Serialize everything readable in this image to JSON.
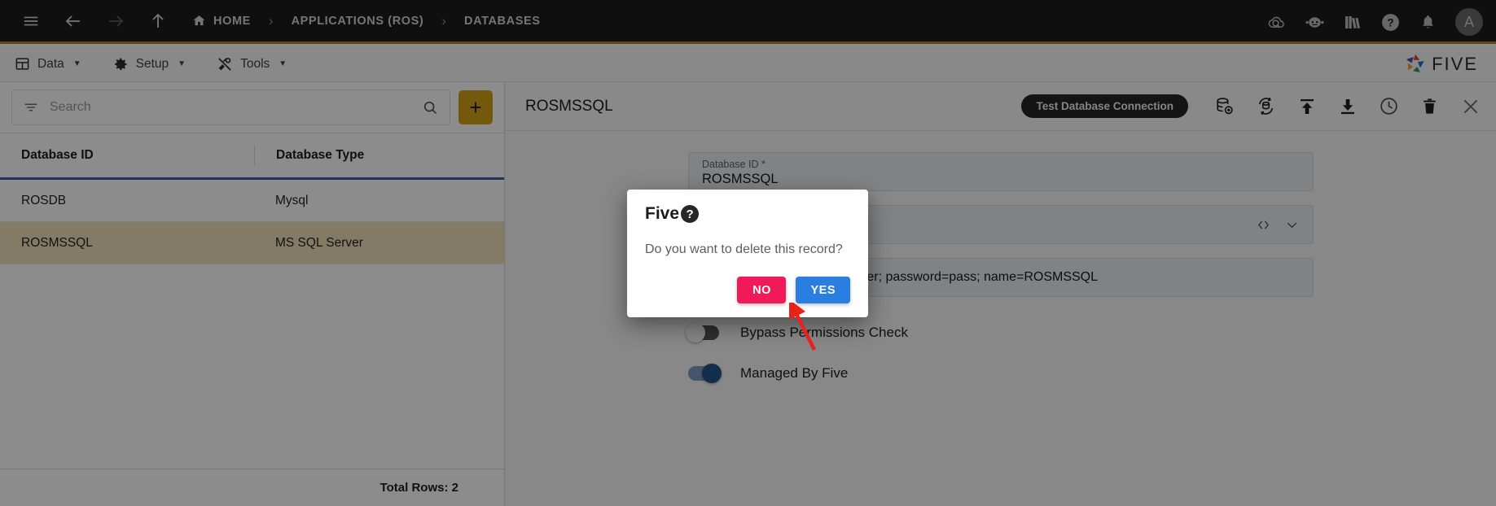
{
  "topbar": {
    "nav_icons": [
      "menu-icon",
      "back-arrow-icon",
      "forward-arrow-icon",
      "up-arrow-icon"
    ],
    "breadcrumb": [
      {
        "label": "HOME",
        "icon": "home-icon"
      },
      {
        "label": "APPLICATIONS (ROS)",
        "icon": ""
      },
      {
        "label": "DATABASES",
        "icon": ""
      }
    ],
    "separator": "›",
    "right_icons": [
      "cloud-check-icon",
      "chat-bot-icon",
      "books-icon",
      "help-icon",
      "bell-icon"
    ],
    "avatar_initial": "A"
  },
  "menubar": {
    "items": [
      {
        "label": "Data",
        "icon": "grid-icon",
        "caret": "▼"
      },
      {
        "label": "Setup",
        "icon": "gear-icon",
        "caret": "▼"
      },
      {
        "label": "Tools",
        "icon": "tools-icon",
        "caret": "▼"
      }
    ],
    "brand": "FIVE"
  },
  "left_panel": {
    "search": {
      "placeholder": "Search",
      "filter_icon": "filter-icon",
      "search_icon": "search-icon"
    },
    "add_button_label": "+",
    "table": {
      "columns": [
        "Database ID",
        "Database Type"
      ],
      "rows": [
        {
          "id": "ROSDB",
          "type": "Mysql",
          "selected": false
        },
        {
          "id": "ROSMSSQL",
          "type": "MS SQL Server",
          "selected": true
        }
      ]
    },
    "status": "Total Rows: 2"
  },
  "right_panel": {
    "title": "ROSMSSQL",
    "tooltip": "Test Database Connection",
    "toolbar_icons": [
      "database-add-icon",
      "database-sync-icon",
      "upload-icon",
      "download-icon",
      "history-clock-icon",
      "delete-trash-icon",
      "close-icon"
    ],
    "fields": {
      "database_id": {
        "label": "Database ID *",
        "value": "ROSMSSQL"
      },
      "database_type": {
        "label": "",
        "value": "",
        "icons": [
          "code-icon",
          "chevron-down-icon"
        ]
      },
      "connection_string": {
        "value": "ost.com:1433; username=user; password=pass; name=ROSMSSQL"
      }
    },
    "toggles": [
      {
        "label": "Bypass Permissions Check",
        "state": "off"
      },
      {
        "label": "Managed By Five",
        "state": "on"
      }
    ]
  },
  "dialog": {
    "title": "Five",
    "title_icon": "question-mark-icon",
    "message": "Do you want to delete this record?",
    "buttons": [
      {
        "label": "NO",
        "kind": "no",
        "color": "#f01a5a"
      },
      {
        "label": "YES",
        "kind": "yes",
        "color": "#2a7de1"
      }
    ]
  },
  "annotation": {
    "arrow": "red-pointer-arrow",
    "color": "#e8221a"
  },
  "colors": {
    "accent_gold": "#d4a017",
    "topbar_bg": "#1c1c1c",
    "selected_row": "#efe0b8",
    "header_underline": "#3a5fa0"
  }
}
